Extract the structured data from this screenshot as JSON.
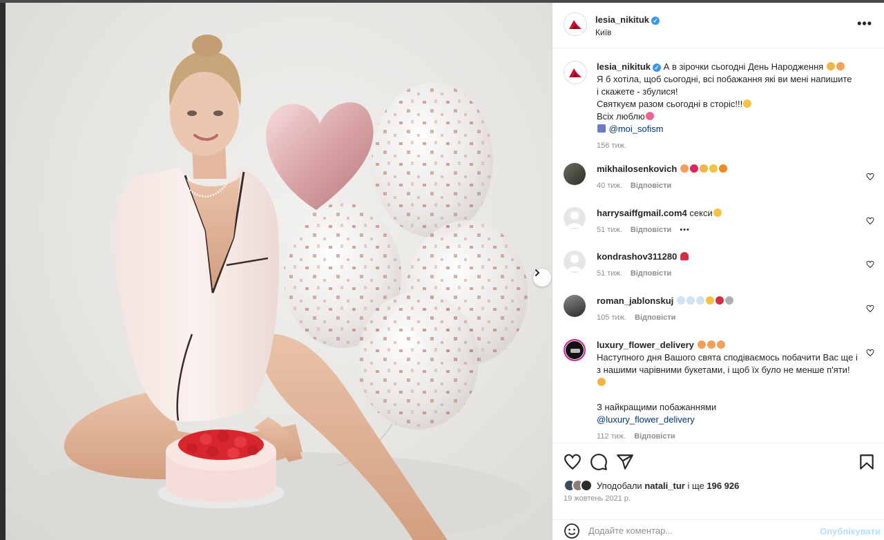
{
  "post": {
    "username": "lesia_nikituk",
    "location": "Київ",
    "more_label": "•••",
    "caption_lines": [
      "А в зірочки сьогодні День Народження",
      "Я б хотіла, щоб сьогодні, всі побажання які ви мені напишите",
      "і скажете - збулися!",
      "Святкуєм разом сьогодні в сторіс!!!",
      "Всіх люблю"
    ],
    "caption_tag": "@moi_sofism",
    "caption_time": "156 тиж."
  },
  "comments": [
    {
      "username": "mikhailosenkovich",
      "text": "",
      "time": "40 тиж.",
      "reply": "Відповісти",
      "more": ""
    },
    {
      "username": "harrysaiffgmail.com4",
      "text": "секси",
      "time": "51 тиж.",
      "reply": "Відповісти",
      "more": "•••"
    },
    {
      "username": "kondrashov311280",
      "text": "",
      "time": "51 тиж.",
      "reply": "Відповісти",
      "more": ""
    },
    {
      "username": "roman_jablonskuj",
      "text": "",
      "time": "105 тиж.",
      "reply": "Відповісти",
      "more": ""
    },
    {
      "username": "luxury_flower_delivery",
      "text": "Наступного дня Вашого свята сподіваємось побачити Вас ще і з нашими чарівними букетами, і щоб їх було не менше п'яти!",
      "text2": "З найкращими побажаннями",
      "tag": "@luxury_flower_delivery",
      "time": "112 тиж.",
      "reply": "Відповісти",
      "more": ""
    }
  ],
  "likes": {
    "prefix": "Уподобали",
    "user": "natali_tur",
    "middle": "і ще",
    "count": "196 926"
  },
  "date": "19 жовтень 2021 р.",
  "add_comment": {
    "placeholder": "Додайте коментар...",
    "publish_label": "Опублікувати"
  },
  "icons": {
    "like": "heart-icon",
    "comment": "comment-icon",
    "share": "send-icon",
    "save": "bookmark-icon",
    "emoji": "smile-icon",
    "next": "chevron-right-icon",
    "verified": "verified-badge-icon"
  },
  "colors": {
    "verified": "#3897f0",
    "link": "#00376b",
    "muted": "#8e8e8e",
    "publish": "#b2dffc"
  }
}
